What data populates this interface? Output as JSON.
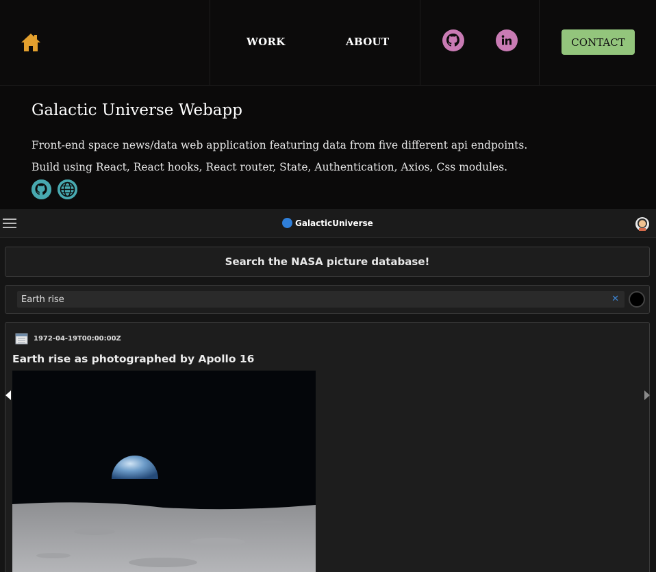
{
  "nav": {
    "home_icon": "home-icon",
    "links": [
      "WORK",
      "ABOUT"
    ],
    "social": [
      "github-icon",
      "linkedin-icon"
    ],
    "contact_label": "CONTACT",
    "colors": {
      "home": "#e3a02e",
      "social": "#c97bb4",
      "contact": "#93c57c"
    }
  },
  "project": {
    "title": "Galactic Universe Webapp",
    "description": "Front-end space news/data web application featuring data from five different api endpoints.",
    "tech": "Build using React, React hooks, React router, State, Authentication, Axios, Css modules.",
    "icons": [
      "github-icon",
      "globe-icon"
    ],
    "icon_color": "#48a9b0"
  },
  "app": {
    "brand": "GalacticUniverse",
    "search_title": "Search the NASA picture database!",
    "search_value": "Earth rise",
    "result": {
      "date": "1972-04-19T00:00:00Z",
      "title": "Earth rise as photographed by Apollo 16"
    }
  }
}
